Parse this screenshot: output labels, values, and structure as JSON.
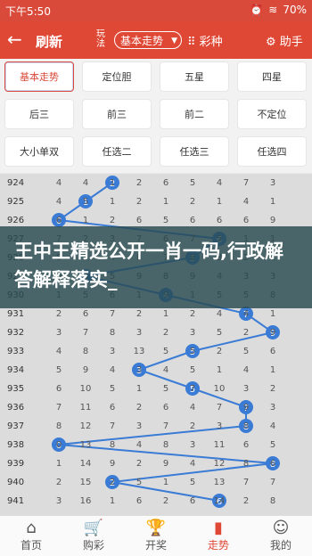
{
  "status": {
    "time": "下午5:50",
    "battery": "70%"
  },
  "appbar": {
    "back_icon": "←",
    "title": "刷新",
    "play_label": "玩法",
    "select_value": "基本走势",
    "caizhong": "彩种",
    "helper": "助手"
  },
  "buttons": [
    "基本走势",
    "定位胆",
    "五星",
    "四星",
    "后三",
    "前三",
    "前二",
    "不定位",
    "大小单双",
    "任选二",
    "任选三",
    "任选四"
  ],
  "table": {
    "periods": [
      "924",
      "925",
      "926",
      "927",
      "928",
      "929",
      "930",
      "931",
      "932",
      "933",
      "934",
      "935",
      "936",
      "937",
      "938",
      "939",
      "940",
      "941"
    ],
    "numbers": [
      [
        "4",
        "4",
        "1",
        "2",
        "6",
        "5",
        "4",
        "7",
        "3"
      ],
      [
        "4",
        "5",
        "1",
        "2",
        "1",
        "2",
        "1",
        "4",
        "1"
      ],
      [
        "6",
        "1",
        "2",
        "6",
        "5",
        "6",
        "6",
        "6",
        "9"
      ],
      [
        "7",
        "2",
        "3",
        "7",
        "6",
        "7",
        "5",
        "1",
        "1"
      ],
      [
        "8",
        "3",
        "4",
        "8",
        "7",
        "8",
        "3",
        "2",
        "2"
      ],
      [
        "9",
        "4",
        "5",
        "9",
        "8",
        "9",
        "4",
        "3",
        "3"
      ],
      [
        "1",
        "5",
        "6",
        "1",
        "9",
        "1",
        "5",
        "5",
        "8"
      ],
      [
        "2",
        "6",
        "7",
        "2",
        "1",
        "2",
        "4",
        "4",
        "1"
      ],
      [
        "3",
        "7",
        "8",
        "3",
        "2",
        "3",
        "5",
        "2",
        "9"
      ],
      [
        "4",
        "8",
        "3",
        "13",
        "5",
        "5",
        "2",
        "5",
        "6"
      ],
      [
        "5",
        "9",
        "4",
        "3",
        "4",
        "5",
        "1",
        "4",
        "1"
      ],
      [
        "6",
        "10",
        "5",
        "1",
        "5",
        "7",
        "10",
        "3",
        "2"
      ],
      [
        "7",
        "11",
        "6",
        "2",
        "6",
        "4",
        "7",
        "9",
        "3"
      ],
      [
        "8",
        "12",
        "7",
        "3",
        "7",
        "2",
        "3",
        "8",
        "4"
      ],
      [
        "0",
        "13",
        "8",
        "4",
        "8",
        "3",
        "11",
        "6",
        "5"
      ],
      [
        "1",
        "14",
        "9",
        "2",
        "9",
        "4",
        "12",
        "8",
        "6"
      ],
      [
        "2",
        "15",
        "2",
        "5",
        "1",
        "5",
        "13",
        "7",
        "7"
      ],
      [
        "3",
        "16",
        "1",
        "6",
        "2",
        "6",
        "14",
        "2",
        "8"
      ]
    ]
  },
  "banner": {
    "text": "王中王精选公开一肖一码,行政解答解释落实_"
  },
  "tabs": [
    {
      "label": "首页",
      "icon": "⌂"
    },
    {
      "label": "购彩",
      "icon": "🛒"
    },
    {
      "label": "开奖",
      "icon": "🏆"
    },
    {
      "label": "走势",
      "icon": "▮"
    },
    {
      "label": "我的",
      "icon": "☺"
    }
  ],
  "colors": {
    "accent": "#e04836",
    "node": "#3a7bd5"
  }
}
